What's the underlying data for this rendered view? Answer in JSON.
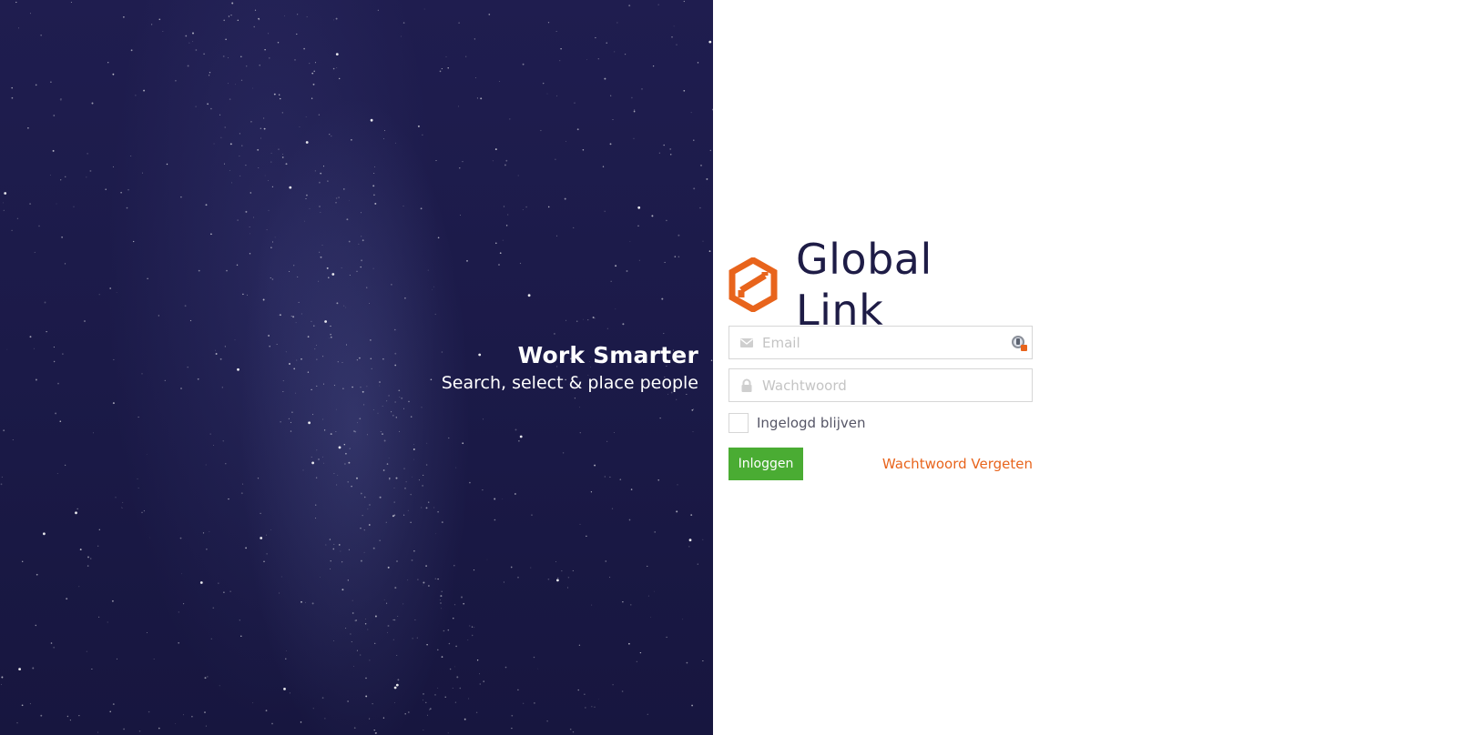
{
  "hero": {
    "title": "Work Smarter",
    "subtitle": "Search, select & place people"
  },
  "brand": {
    "name": "Global Link",
    "logo_icon": "global-link-hexagon-logo",
    "logo_color": "#e8641c",
    "name_color": "#1e1c46"
  },
  "form": {
    "email": {
      "placeholder": "Email",
      "value": "",
      "icon": "envelope-icon"
    },
    "password": {
      "placeholder": "Wachtwoord",
      "value": "",
      "icon": "lock-icon"
    },
    "remember_label": "Ingelogd blijven",
    "remember_checked": false,
    "login_label": "Inloggen",
    "forgot_label": "Wachtwoord Vergeten"
  },
  "colors": {
    "accent_green": "#4aac33",
    "accent_orange": "#e8641c",
    "hero_background": "#1d1b4b"
  }
}
